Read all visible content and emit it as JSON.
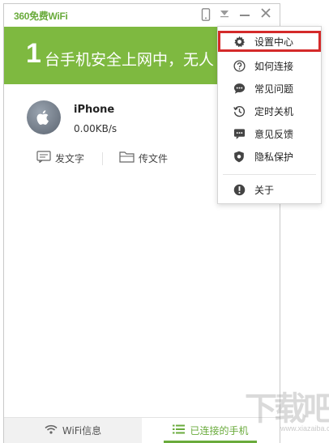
{
  "app": {
    "logo_text": "360免费WiFi",
    "brand_color": "#7eb940",
    "accent_text_color": "#6aab3c",
    "titlebar_icons": [
      "phone-icon",
      "dropdown-icon",
      "minimize-icon",
      "close-icon"
    ]
  },
  "hero": {
    "count": "1",
    "message": "台手机安全上网中，无人"
  },
  "device": {
    "name": "iPhone",
    "speed": "0.00KB/s",
    "icon": "apple-icon",
    "actions": [
      {
        "label": "发文字",
        "icon": "message-icon"
      },
      {
        "label": "传文件",
        "icon": "folder-icon"
      }
    ]
  },
  "bottom_tabs": [
    {
      "label": "WiFi信息",
      "icon": "wifi-icon",
      "active": false
    },
    {
      "label": "已连接的手机",
      "icon": "list-icon",
      "active": true
    }
  ],
  "menu": {
    "highlight_color": "#d42a2a",
    "items": [
      {
        "label": "设置中心",
        "icon": "gear-icon",
        "highlighted": true
      },
      {
        "label": "如何连接",
        "icon": "question-icon"
      },
      {
        "label": "常见问题",
        "icon": "chat-icon"
      },
      {
        "label": "定时关机",
        "icon": "clock-history-icon"
      },
      {
        "label": "意见反馈",
        "icon": "feedback-icon"
      },
      {
        "label": "隐私保护",
        "icon": "shield-icon"
      },
      {
        "label": "关于",
        "icon": "info-icon"
      }
    ]
  },
  "watermark": {
    "text": "下载吧",
    "url": "www.xiazaiba.com"
  }
}
